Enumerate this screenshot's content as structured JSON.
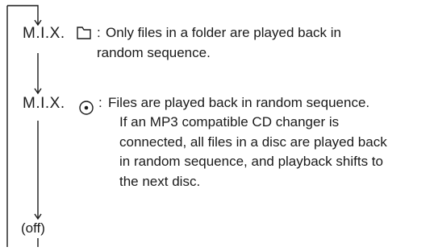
{
  "modes": [
    {
      "label": "M.I.X.",
      "icon": "folder-icon",
      "separator": ":",
      "description": [
        "Only files in a folder are played back in",
        "random sequence."
      ]
    },
    {
      "label": "M.I.X.",
      "icon": "disc-icon",
      "separator": ":",
      "description": [
        "Files are played back in random sequence.",
        "If an MP3 compatible CD changer is",
        "connected, all files in a disc are played back",
        "in random sequence, and playback shifts to",
        "the next disc."
      ]
    },
    {
      "label": "(off)"
    }
  ]
}
